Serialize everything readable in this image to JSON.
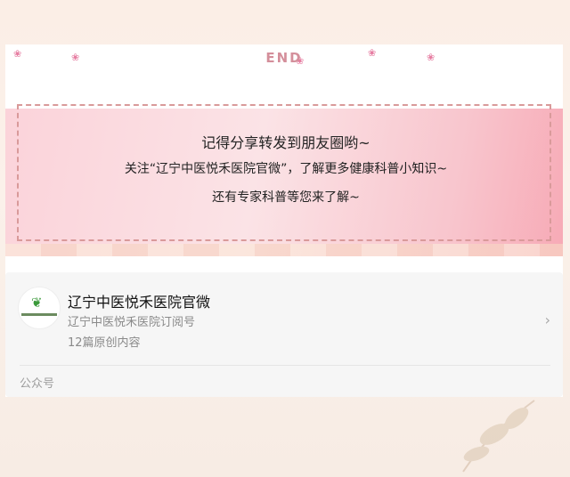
{
  "end_marker": "END",
  "banner": {
    "line1": "记得分享转发到朋友圈哟~",
    "line2": "关注“辽宁中医悦禾医院官微”，了解更多健康科普小知识~",
    "line3": "还有专家科普等您来了解~"
  },
  "profile": {
    "name": "辽宁中医悦禾医院官微",
    "subtitle": "辽宁中医悦禾医院订阅号",
    "count": "12篇原创内容",
    "footer_label": "公众号",
    "avatar_icon": "hospital-logo-icon",
    "chevron_icon": "chevron-right-icon"
  },
  "colors": {
    "accent_pink": "#d48f9b",
    "banner_pink": "#f8c5cd"
  }
}
